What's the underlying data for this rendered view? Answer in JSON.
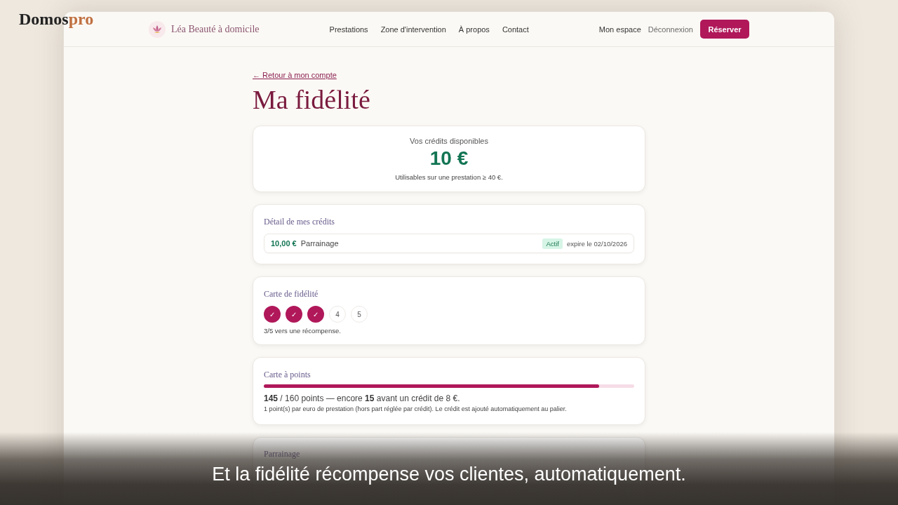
{
  "overlay_logo": {
    "main": "Domos",
    "accent": "pro"
  },
  "header": {
    "brand": "Léa Beauté à domicile",
    "nav": [
      "Prestations",
      "Zone d'intervention",
      "À propos",
      "Contact"
    ],
    "account_link": "Mon espace",
    "logout_link": "Déconnexion",
    "cta": "Réserver"
  },
  "back_link": "← Retour à mon compte",
  "title": "Ma fidélité",
  "credits_card": {
    "label": "Vos crédits disponibles",
    "amount": "10 €",
    "note": "Utilisables sur une prestation ≥ 40 €."
  },
  "credit_details": {
    "title": "Détail de mes crédits",
    "items": [
      {
        "amount": "10,00 €",
        "source": "Parrainage",
        "status": "Actif",
        "expiry": "expire le 02/10/2026"
      }
    ]
  },
  "loyalty_card": {
    "title": "Carte de fidélité",
    "stamps": [
      {
        "label": "✓",
        "filled": true
      },
      {
        "label": "✓",
        "filled": true
      },
      {
        "label": "✓",
        "filled": true
      },
      {
        "label": "4",
        "filled": false
      },
      {
        "label": "5",
        "filled": false
      }
    ],
    "progress_text": "3/5 vers une récompense."
  },
  "points_card": {
    "title": "Carte à points",
    "level": 0.906,
    "summary": "**145** / 160 points — encore **15** avant un crédit de 8 €.",
    "note": "1 point(s) par euro de prestation (hors part réglée par crédit). Le crédit est ajouté automatiquement au palier."
  },
  "referral_card": {
    "title": "Parrainage"
  },
  "caption": "Et la fidélité récompense vos clientes, automatiquement."
}
